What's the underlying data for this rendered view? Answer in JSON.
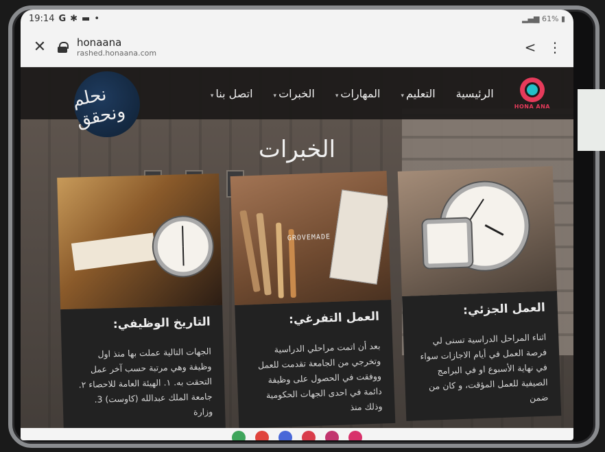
{
  "status_bar": {
    "time": "19:14",
    "icons": [
      "google-icon",
      "bluetooth-icon",
      "message-icon"
    ],
    "battery": "61%"
  },
  "browser": {
    "site_title": "honaana",
    "site_url": "rashed.honaana.com"
  },
  "nav": {
    "items": [
      {
        "label": "الرئيسية",
        "has_caret": false
      },
      {
        "label": "التعليم",
        "has_caret": true
      },
      {
        "label": "المهارات",
        "has_caret": true
      },
      {
        "label": "الخبرات",
        "has_caret": true
      },
      {
        "label": "اتصل بنا",
        "has_caret": true
      }
    ],
    "brand_text": "HONA ANA",
    "emblem_text": "نحلم ونحقق"
  },
  "section": {
    "title": "الخبرات"
  },
  "cards": [
    {
      "title": "العمل الجزئي:",
      "body": "اثناء المراحل الدراسية تسنى لي فرصة العمل في أيام الاجازات سواء في نهاية الأسبوع او في البرامج الصيفية للعمل المؤقت، و كان من ضمن"
    },
    {
      "title": "العمل التفرغي:",
      "body": "بعد أن اتمت مراحلي الدراسية وتخرجي من الجامعة تقدمت للعمل ووفقت في الحصول على وظيفة دائمة في احدى الجهات الحكومية وذلك منذ"
    },
    {
      "title": "التاريخ الوظيفي:",
      "body": "الجهات التالية عملت بها منذ اول وظيفة وهي مرتبة حسب آخر عمل التحقت به. ١. الهيئة العامة للاحصاء ٢. جامعة الملك عبدالله (كاوست) 3. وزارة"
    }
  ],
  "images": {
    "mid_brand": "GROVEMADE"
  },
  "colors": {
    "brand_pink": "#e63b5b",
    "brand_teal": "#23c1c9",
    "navbar_bg": "#1c1a19",
    "card_panel": "#222222"
  }
}
